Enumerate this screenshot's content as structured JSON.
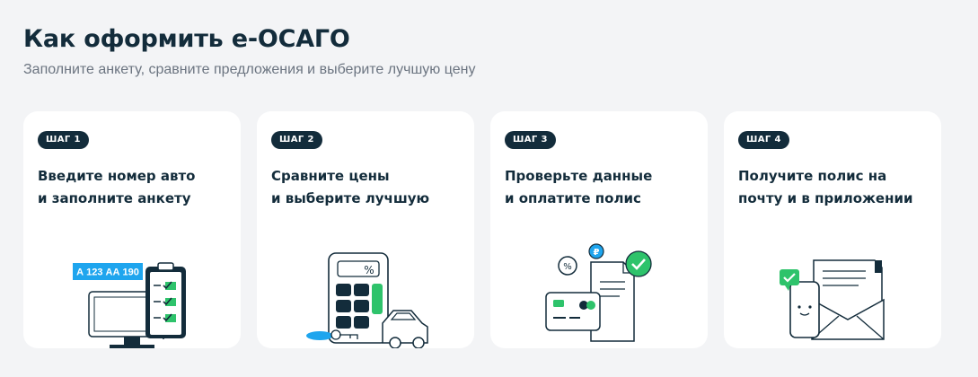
{
  "header": {
    "title": "Как оформить е-ОСАГО",
    "subtitle": "Заполните анкету, сравните предложения и выберите лучшую цену"
  },
  "steps": [
    {
      "badge": "ШАГ 1",
      "line1": "Введите номер авто",
      "line2": "и заполните анкету",
      "plate": "А 123 АА 190",
      "icon": "monitor-clipboard-icon"
    },
    {
      "badge": "ШАГ 2",
      "line1": "Сравните цены",
      "line2": "и выберите лучшую",
      "percent": "%",
      "icon": "calculator-car-icon"
    },
    {
      "badge": "ШАГ 3",
      "line1": "Проверьте данные",
      "line2": "и оплатите полис",
      "percent": "%",
      "currency": "₽",
      "icon": "card-document-check-icon"
    },
    {
      "badge": "ШАГ 4",
      "line1": "Получите полис на",
      "line2": "почту и в приложении",
      "icon": "phone-envelope-icon"
    }
  ],
  "colors": {
    "background": "#f3f4f6",
    "card": "#ffffff",
    "dark": "#132c3b",
    "accent_blue": "#1ea5ee",
    "accent_green": "#2ec36b",
    "muted_text": "#6b7480"
  }
}
